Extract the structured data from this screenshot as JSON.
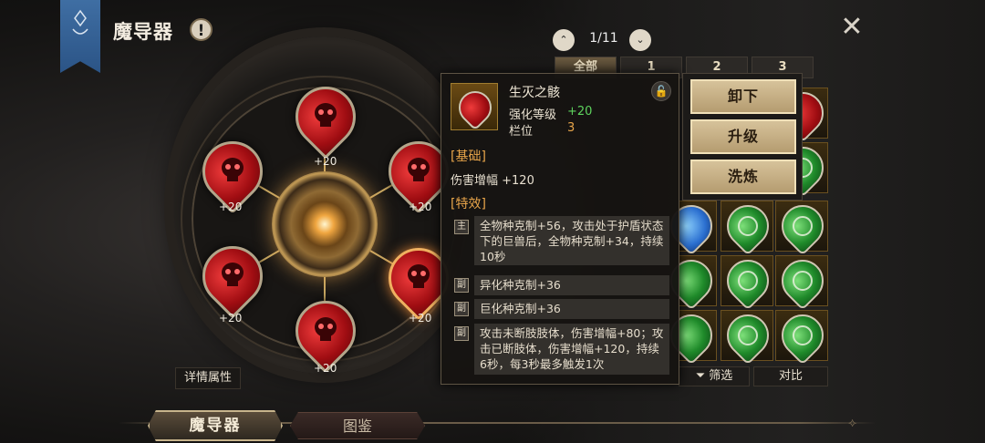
{
  "header": {
    "title": "魔导器",
    "info_label": "!",
    "close_label": "✕"
  },
  "wheel": {
    "slots": [
      {
        "label": "+20"
      },
      {
        "label": "+20"
      },
      {
        "label": "+20"
      },
      {
        "label": "+20"
      },
      {
        "label": "+20"
      },
      {
        "label": "+20"
      }
    ],
    "detail_button": "详情属性"
  },
  "bottom_tabs": {
    "main": "魔导器",
    "atlas": "图鉴"
  },
  "pager": {
    "prev": "⌃",
    "next": "⌄",
    "count": "1/11"
  },
  "filter_tabs": [
    "全部",
    "1",
    "2",
    "3"
  ],
  "tooltip": {
    "name": "生灭之骸",
    "lock_icon": "lock-icon",
    "enhance_label": "强化等级",
    "enhance_value": "+20",
    "slot_label": "栏位",
    "slot_value": "3",
    "basic_header": "[基础]",
    "basic_stat": "伤害增幅 +120",
    "effect_header": "[特效]",
    "effects": [
      {
        "tag": "主",
        "text": "全物种克制+56，攻击处于护盾状态下的巨兽后，全物种克制+34，持续10秒"
      },
      {
        "tag": "副",
        "text": "异化种克制+36"
      },
      {
        "tag": "副",
        "text": "巨化种克制+36"
      },
      {
        "tag": "副",
        "text": "攻击未断肢肢体，伤害增幅+80；攻击已断肢体，伤害增幅+120，持续6秒，每3秒最多触发1次"
      }
    ]
  },
  "actions": {
    "unequip": "卸下",
    "upgrade": "升级",
    "refine": "洗炼"
  },
  "bottom_bar": {
    "filter": "筛选",
    "compare": "对比"
  },
  "colors": {
    "accent_gold": "#c7b48c",
    "enhance_green": "#5ed35e",
    "slot_orange": "#e8a54a",
    "section_orange": "#e8a54a"
  }
}
